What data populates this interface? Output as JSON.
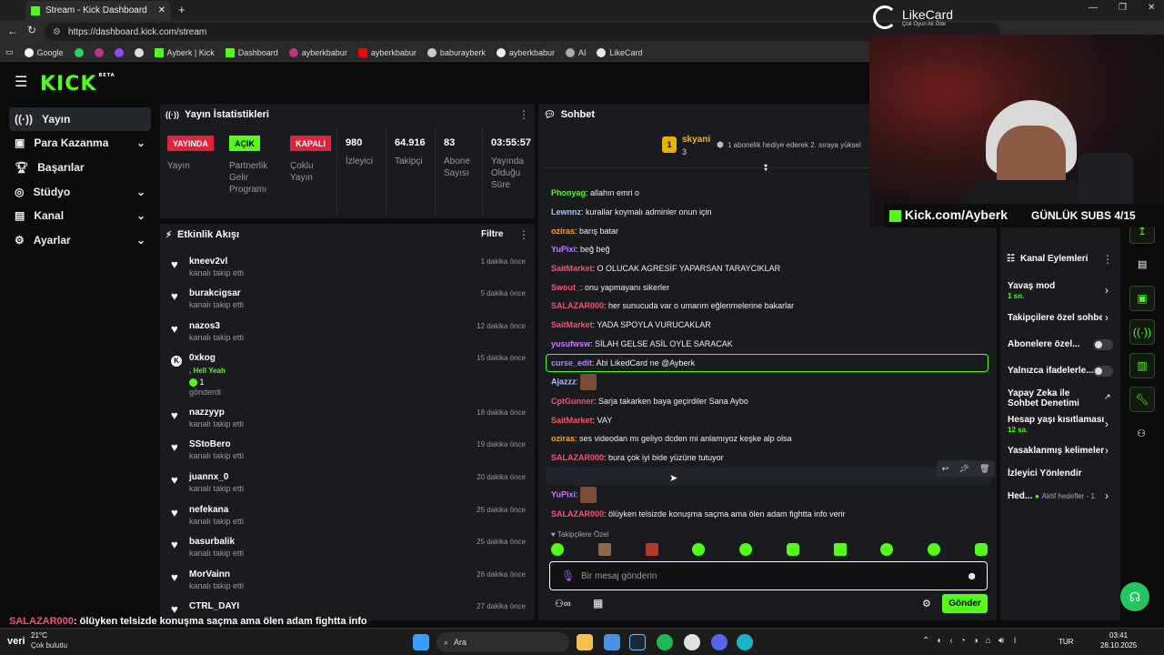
{
  "browser": {
    "tab_title": "Stream - Kick Dashboard",
    "url": "https://dashboard.kick.com/stream",
    "bookmarks": [
      "Google",
      "Ayberk | Kick",
      "Dashboard",
      "ayberkbabur",
      "ayberkbabur",
      "baburayberk",
      "ayberkbabur",
      "AI",
      "LikeCard"
    ]
  },
  "header": {
    "logo": "KICK",
    "beta": "BETA"
  },
  "sidebar": {
    "items": [
      {
        "label": "Yayın"
      },
      {
        "label": "Para Kazanma"
      },
      {
        "label": "Başarılar"
      },
      {
        "label": "Stüdyo"
      },
      {
        "label": "Kanal"
      },
      {
        "label": "Ayarlar"
      }
    ]
  },
  "stats": {
    "title": "Yayın İstatistikleri",
    "badges": [
      {
        "badge": "YAYINDA",
        "label": "Yayın",
        "color": "#e0233a"
      },
      {
        "badge": "AÇIK",
        "label": "Partnerlik Gelir Programı",
        "color": "#53fc18"
      },
      {
        "badge": "KAPALI",
        "label": "Çoklu Yayın",
        "color": "#e0233a"
      }
    ],
    "values": [
      {
        "value": "980",
        "label": "İzleyici"
      },
      {
        "value": "64.916",
        "label": "Takipçi"
      },
      {
        "value": "83",
        "label": "Abone Sayısı"
      },
      {
        "value": "03:55:57",
        "label": "Yayında Olduğu Süre"
      }
    ]
  },
  "activity": {
    "title": "Etkinlik Akışı",
    "filter": "Filtre",
    "items": [
      {
        "name": "kneev2vl",
        "sub": "kanalı takip etti",
        "time": "1 dakika önce"
      },
      {
        "name": "burakcigsar",
        "sub": "kanalı takip etti",
        "time": "5 dakika önce"
      },
      {
        "name": "nazos3",
        "sub": "kanalı takip etti",
        "time": "12 dakika önce"
      },
      {
        "name": "0xkog",
        "sub": "gönderdi",
        "time": "15 dakika önce",
        "extra": ", Hell Yeah",
        "count": "1"
      },
      {
        "name": "nazzyyp",
        "sub": "kanalı takip etti",
        "time": "18 dakika önce"
      },
      {
        "name": "SStoBero",
        "sub": "kanalı takip etti",
        "time": "19 dakika önce"
      },
      {
        "name": "juannx_0",
        "sub": "kanalı takip etti",
        "time": "20 dakika önce"
      },
      {
        "name": "nefekana",
        "sub": "kanalı takip etti",
        "time": "25 dakika önce"
      },
      {
        "name": "basurbalik",
        "sub": "kanalı takip etti",
        "time": "25 dakika önce"
      },
      {
        "name": "MorVainn",
        "sub": "kanalı takip etti",
        "time": "26 dakika önce"
      },
      {
        "name": "CTRL_DAYI",
        "sub": "",
        "time": "27 dakika önce"
      }
    ]
  },
  "chat": {
    "title": "Sohbet",
    "pinned_user": "skyani",
    "pinned_count": "3",
    "pinned_text": "1 abonelik hediye ederek 2. sıraya yüksel",
    "messages": [
      {
        "user": "Phonyag",
        "color": "#53fc18",
        "text": ": allahın emri o"
      },
      {
        "user": "Lewnnz",
        "color": "#9ec7ff",
        "text": ": kurallar koymalı adminler onun için"
      },
      {
        "user": "oziras",
        "color": "#ff9f2e",
        "text": ": barış batar"
      },
      {
        "user": "YuPixi",
        "color": "#c77dff",
        "text": ": beğ beğ"
      },
      {
        "user": "SaitMarket",
        "color": "#ff4d6d",
        "text": ": O OLUCAK AGRESİF YAPARSAN TARAYCIKLAR"
      },
      {
        "user": "Swout_",
        "color": "#ff4d6d",
        "text": ": onu yapmayanı sikerler"
      },
      {
        "user": "SALAZAR000",
        "color": "#ff4d6d",
        "text": ": her sunucuda var o umarım eğlenmelerine bakarlar"
      },
      {
        "user": "SaitMarket",
        "color": "#ff4d6d",
        "text": ": YADA SPOYLA VURUCAKLAR"
      },
      {
        "user": "yusufwsw",
        "color": "#c77dff",
        "text": ": SİLAH GELSE ASİL OYLE SARACAK"
      },
      {
        "user": "curse_edit",
        "color": "#c77dff",
        "text": ": Abi LikedCard ne @Ayberk"
      },
      {
        "user": "Ajazzz",
        "color": "#9ec7ff",
        "text": ":"
      },
      {
        "user": "CptGunner",
        "color": "#ff4d6d",
        "text": ": Sarja takarken baya geçirdiler Sana Aybo"
      },
      {
        "user": "SaitMarket",
        "color": "#ff4d6d",
        "text": ": VAY"
      },
      {
        "user": "oziras",
        "color": "#ff9f2e",
        "text": ": ses videodan mı geliyo dcden mi anlamıyoz keşke alp olsa"
      },
      {
        "user": "SALAZAR000",
        "color": "#ff4d6d",
        "text": ": bura çok iyi bide yüzüne tutuyor"
      },
      {
        "user": "YuPixi",
        "color": "#c77dff",
        "text": ":"
      },
      {
        "user": "YuPixi",
        "color": "#c77dff",
        "text": ":"
      },
      {
        "user": "SALAZAR000",
        "color": "#ff4d6d",
        "text": ": ölüyken telsizde konuşma saçma ama ölen adam fightta info verir"
      }
    ],
    "followers_only": "Takipçilere Özel",
    "input_placeholder": "Bir mesaj gönderin",
    "send": "Gönder"
  },
  "channel_actions": {
    "title": "Kanal Eylemleri",
    "items": [
      {
        "label": "Yavaş mod",
        "sub": "1 sn."
      },
      {
        "label": "Takipçilere özel sohbet"
      },
      {
        "label": "Abonelere özel..."
      },
      {
        "label": "Yalnızca ifadelerle..."
      },
      {
        "label": "Yapay Zeka ile Sohbet Denetimi"
      },
      {
        "label": "Hesap yaşı kısıtlaması",
        "sub": "12 sa."
      },
      {
        "label": "Yasaklanmış kelimeler"
      },
      {
        "label": "İzleyici Yönlendir"
      },
      {
        "label": "Hed...",
        "sub": "Aktif hedefler - 1"
      }
    ]
  },
  "overlay": {
    "brand": "LikeCard",
    "brand_sub": "Çok Oyun Ak Öde",
    "kick_url": "Kick.com/Ayberk",
    "subs": "GÜNLÜK SUBS 4/15",
    "ticker_user": "SALAZAR000",
    "ticker_text": ": ölüyken telsizde konuşma saçma ama ölen adam fightta info"
  },
  "taskbar": {
    "weather_temp": "21°C",
    "weather_desc": "Çok bulutlu",
    "weather_label": "veri",
    "search": "Ara",
    "lang": "TUR",
    "time": "03:41",
    "date": "28.10.2025"
  }
}
